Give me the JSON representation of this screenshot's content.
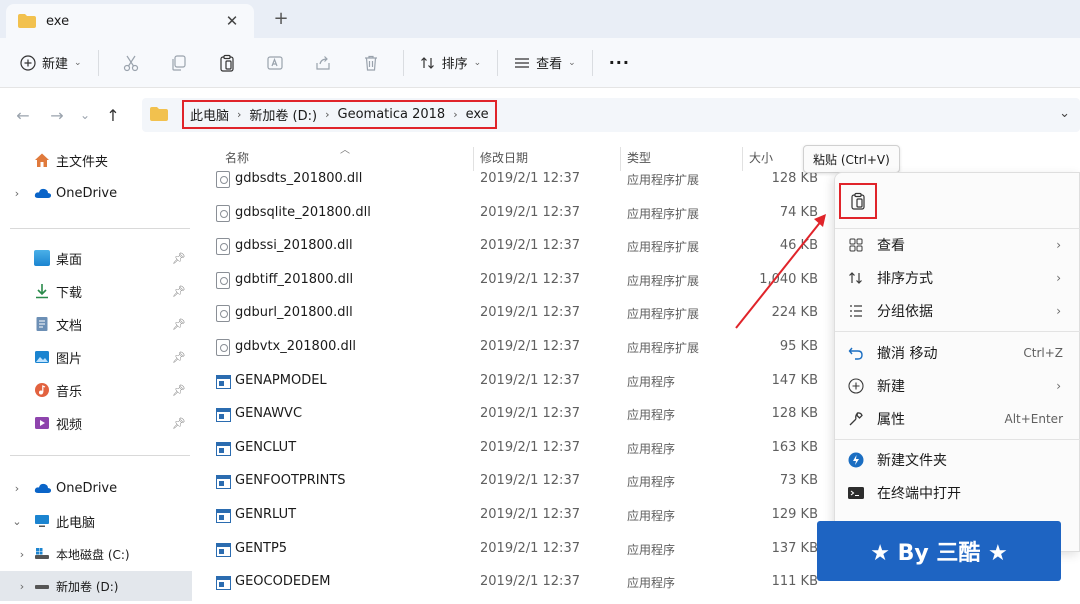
{
  "tab": {
    "title": "exe",
    "close": "✕",
    "add": "+"
  },
  "toolbar": {
    "new_label": "新建",
    "sort_label": "排序",
    "view_label": "查看",
    "more": "···"
  },
  "breadcrumb": [
    "此电脑",
    "新加卷 (D:)",
    "Geomatica 2018",
    "exe"
  ],
  "sidebar": {
    "home": "主文件夹",
    "onedrive": "OneDrive",
    "quick": [
      "桌面",
      "下载",
      "文档",
      "图片",
      "音乐",
      "视频"
    ],
    "onedrive2": "OneDrive",
    "thispc": "此电脑",
    "drive_c": "本地磁盘 (C:)",
    "drive_d": "新加卷 (D:)"
  },
  "columns": {
    "name": "名称",
    "date": "修改日期",
    "type": "类型",
    "size": "大小"
  },
  "files": [
    {
      "name": "gdbsdts_201800.dll",
      "date": "2019/2/1 12:37",
      "type": "应用程序扩展",
      "size": "128 KB",
      "kind": "dll"
    },
    {
      "name": "gdbsqlite_201800.dll",
      "date": "2019/2/1 12:37",
      "type": "应用程序扩展",
      "size": "74 KB",
      "kind": "dll"
    },
    {
      "name": "gdbssi_201800.dll",
      "date": "2019/2/1 12:37",
      "type": "应用程序扩展",
      "size": "46 KB",
      "kind": "dll"
    },
    {
      "name": "gdbtiff_201800.dll",
      "date": "2019/2/1 12:37",
      "type": "应用程序扩展",
      "size": "1,040 KB",
      "kind": "dll"
    },
    {
      "name": "gdburl_201800.dll",
      "date": "2019/2/1 12:37",
      "type": "应用程序扩展",
      "size": "224 KB",
      "kind": "dll"
    },
    {
      "name": "gdbvtx_201800.dll",
      "date": "2019/2/1 12:37",
      "type": "应用程序扩展",
      "size": "95 KB",
      "kind": "dll"
    },
    {
      "name": "GENAPMODEL",
      "date": "2019/2/1 12:37",
      "type": "应用程序",
      "size": "147 KB",
      "kind": "exe"
    },
    {
      "name": "GENAWVC",
      "date": "2019/2/1 12:37",
      "type": "应用程序",
      "size": "128 KB",
      "kind": "exe"
    },
    {
      "name": "GENCLUT",
      "date": "2019/2/1 12:37",
      "type": "应用程序",
      "size": "163 KB",
      "kind": "exe"
    },
    {
      "name": "GENFOOTPRINTS",
      "date": "2019/2/1 12:37",
      "type": "应用程序",
      "size": "73 KB",
      "kind": "exe"
    },
    {
      "name": "GENRLUT",
      "date": "2019/2/1 12:37",
      "type": "应用程序",
      "size": "129 KB",
      "kind": "exe"
    },
    {
      "name": "GENTP5",
      "date": "2019/2/1 12:37",
      "type": "应用程序",
      "size": "137 KB",
      "kind": "exe"
    },
    {
      "name": "GEOCODEDEM",
      "date": "2019/2/1 12:37",
      "type": "应用程序",
      "size": "111 KB",
      "kind": "exe"
    }
  ],
  "tooltip": "粘贴 (Ctrl+V)",
  "context_menu": {
    "view": "查看",
    "sort": "排序方式",
    "group": "分组依据",
    "undo": "撤消 移动",
    "undo_shortcut": "Ctrl+Z",
    "new": "新建",
    "properties": "属性",
    "properties_shortcut": "Alt+Enter",
    "new_folder": "新建文件夹",
    "terminal": "在终端中打开"
  },
  "watermark": "★ By 三酷 ★",
  "colors": {
    "accent": "#1e64c2",
    "highlight": "#e0242a",
    "folder": "#f2c14e"
  }
}
